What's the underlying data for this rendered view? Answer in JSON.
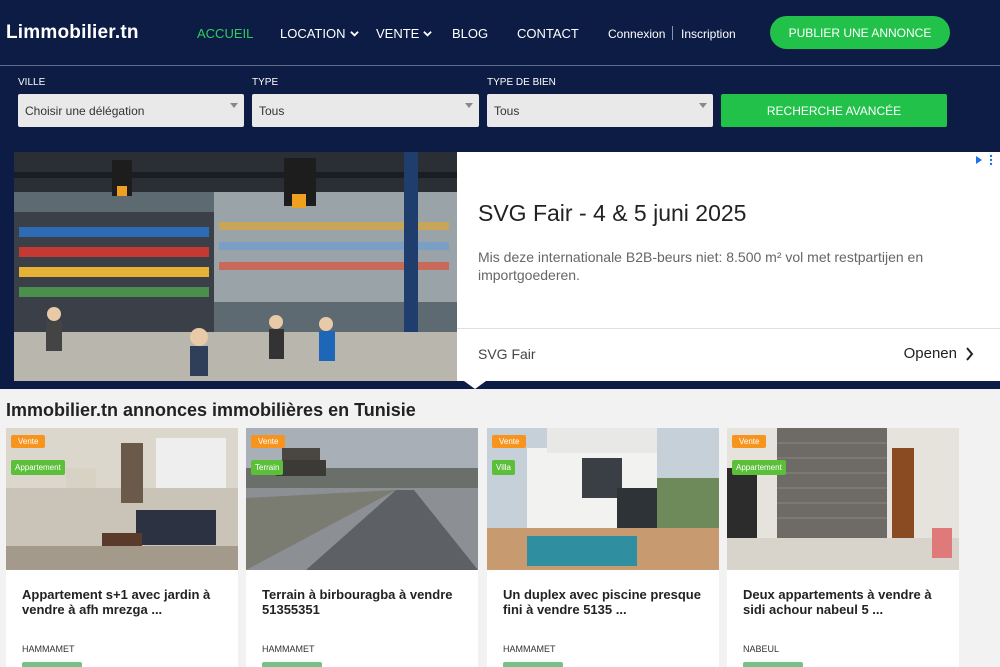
{
  "header": {
    "logo": "Limmobilier.tn",
    "nav": [
      {
        "label": "ACCUEIL",
        "active": true
      },
      {
        "label": "LOCATION",
        "dropdown": true
      },
      {
        "label": "VENTE",
        "dropdown": true
      },
      {
        "label": "BLOG"
      },
      {
        "label": "CONTACT"
      }
    ],
    "login": "Connexion",
    "register": "Inscription",
    "publish": "PUBLIER UNE ANNONCE"
  },
  "search": {
    "ville_label": "VILLE",
    "ville_value": "Choisir une délégation",
    "type_label": "TYPE",
    "type_value": "Tous",
    "bien_label": "TYPE DE BIEN",
    "bien_value": "Tous",
    "advanced": "RECHERCHE AVANCÉE"
  },
  "ad": {
    "title": "SVG Fair - 4 & 5 juni 2025",
    "description": "Mis deze internationale B2B-beurs niet: 8.500 m² vol met restpartijen en importgoederen.",
    "brand": "SVG Fair",
    "cta": "Openen"
  },
  "listings": {
    "heading": "Immobilier.tn annonces immobilières en Tunisie",
    "items": [
      {
        "status": "Vente",
        "type": "Appartement",
        "title": "Appartement s+1 avec jardin à vendre à afh mrezga ...",
        "city": "HAMMAMET"
      },
      {
        "status": "Vente",
        "type": "Terrain",
        "title": "Terrain à birbouragba à vendre 51355351",
        "city": "HAMMAMET"
      },
      {
        "status": "Vente",
        "type": "Villa",
        "title": "Un duplex avec piscine presque fini à vendre 5135 ...",
        "city": "HAMMAMET"
      },
      {
        "status": "Vente",
        "type": "Appartement",
        "title": "Deux appartements à vendre à sidi achour nabeul 5 ...",
        "city": "NABEUL"
      }
    ]
  },
  "colors": {
    "navy": "#0c1c44",
    "green": "#22c24a",
    "orange": "#f7941d",
    "accent": "#2fce5c"
  }
}
